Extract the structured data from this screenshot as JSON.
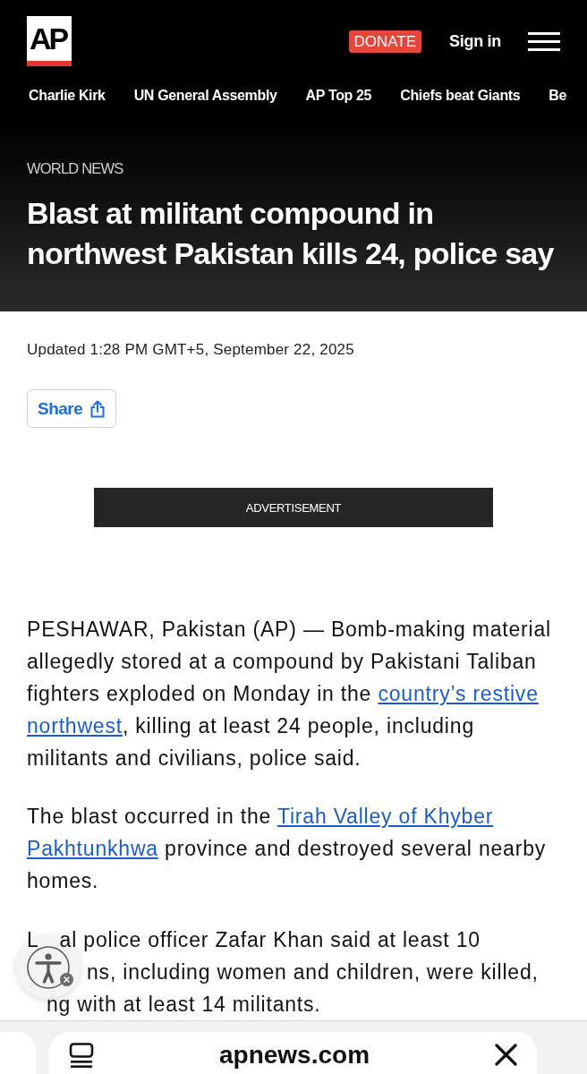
{
  "header": {
    "logo": "AP",
    "donate_button": "DONATE",
    "sign_in": "Sign in"
  },
  "nav_links": [
    {
      "label": "Charlie Kirk"
    },
    {
      "label": "UN General Assembly"
    },
    {
      "label": "AP Top 25"
    },
    {
      "label": "Chiefs beat Giants"
    },
    {
      "label": "Be"
    }
  ],
  "article": {
    "section": "WORLD NEWS",
    "headline": "Blast at militant compound in northwest Pakistan kills 24, police say",
    "updated": "Updated 1:28 PM GMT+5, September 22, 2025",
    "share_button": "Share",
    "advertisement": "ADVERTISEMENT",
    "paragraphs": [
      {
        "kind": "text",
        "segments": [
          {
            "kind": "text",
            "text": "PESHAWAR, Pakistan (AP) — Bomb-making material allegedly stored at a compound by Pakistani Taliban fighters exploded on Monday in the "
          },
          {
            "kind": "link",
            "text": "country’s restive"
          },
          {
            "kind": "link",
            "text": "northwest"
          },
          {
            "kind": "text",
            "text": ", killing at least 24 people, including militants and civilians, police said."
          }
        ]
      },
      {
        "kind": "text",
        "segments": [
          {
            "kind": "text",
            "text": "The blast occurred in the "
          },
          {
            "kind": "link",
            "text": "Tirah Valley of Khyber"
          },
          {
            "kind": "link",
            "text": "Pakhtunkhwa"
          },
          {
            "kind": "text",
            "text": " province and destroyed several nearby homes."
          }
        ]
      },
      {
        "kind": "covered",
        "lines": [
          {
            "parts": [
              "L",
              "al police officer Zafar Khan said at least 10"
            ]
          },
          {
            "parts": [
              "ns, including women and children, were killed,"
            ]
          },
          {
            "parts": [
              "ng with at least 14 militants."
            ]
          }
        ]
      }
    ]
  },
  "browser_bar": {
    "url": "apnews.com"
  }
}
